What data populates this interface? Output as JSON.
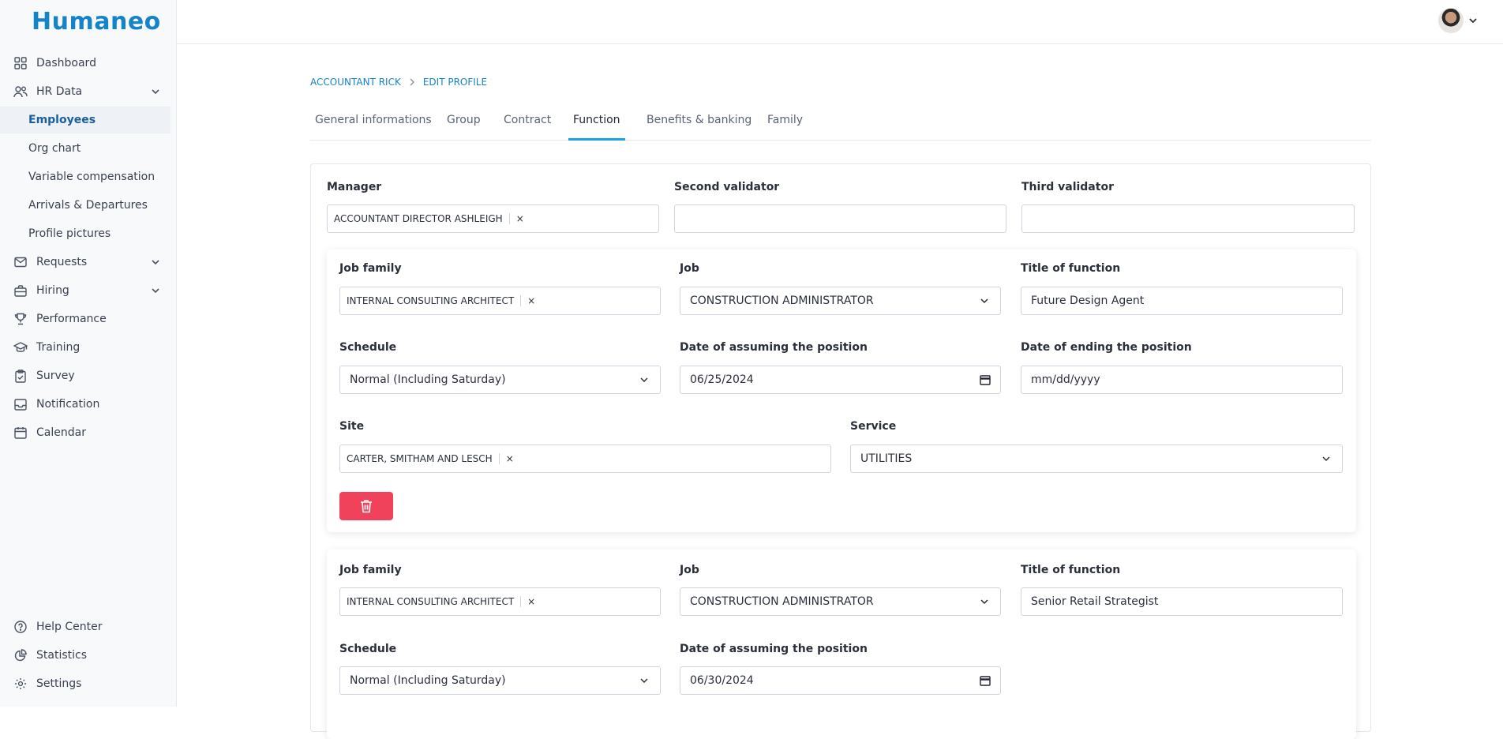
{
  "app": {
    "logo": "Humaneo"
  },
  "sidebar": {
    "items": [
      {
        "label": "Dashboard",
        "icon": "dashboard-icon"
      },
      {
        "label": "HR Data",
        "icon": "people-icon"
      },
      {
        "label": "Employees"
      },
      {
        "label": "Org chart"
      },
      {
        "label": "Variable compensation"
      },
      {
        "label": "Arrivals & Departures"
      },
      {
        "label": "Profile pictures"
      },
      {
        "label": "Requests",
        "icon": "mail-icon"
      },
      {
        "label": "Hiring",
        "icon": "briefcase-icon"
      },
      {
        "label": "Performance",
        "icon": "trophy-icon"
      },
      {
        "label": "Training",
        "icon": "graduation-cap-icon"
      },
      {
        "label": "Survey",
        "icon": "clipboard-icon"
      },
      {
        "label": "Notification",
        "icon": "inbox-icon"
      },
      {
        "label": "Calendar",
        "icon": "calendar-icon"
      }
    ],
    "bottom": [
      {
        "label": "Help Center",
        "icon": "help-icon"
      },
      {
        "label": "Statistics",
        "icon": "chart-pie-icon"
      },
      {
        "label": "Settings",
        "icon": "gear-icon"
      }
    ]
  },
  "breadcrumb": {
    "parent": "ACCOUNTANT RICK",
    "current": "EDIT PROFILE"
  },
  "tabs": [
    "General informations",
    "Group",
    "Contract",
    "Function",
    "Benefits & banking",
    "Family"
  ],
  "validators": {
    "manager_label": "Manager",
    "manager_value": "ACCOUNTANT DIRECTOR ASHLEIGH",
    "second_label": "Second validator",
    "second_value": "",
    "third_label": "Third validator",
    "third_value": ""
  },
  "functions": [
    {
      "job_family_label": "Job family",
      "job_family": "INTERNAL CONSULTING ARCHITECT",
      "job_label": "Job",
      "job": "CONSTRUCTION ADMINISTRATOR",
      "title_label": "Title of function",
      "title": "Future Design Agent",
      "schedule_label": "Schedule",
      "schedule": "Normal (Including Saturday)",
      "start_label": "Date of assuming the position",
      "start": "06/25/2024",
      "end_label": "Date of ending the position",
      "end": "mm/dd/yyyy",
      "site_label": "Site",
      "site": "CARTER, SMITHAM AND LESCH",
      "service_label": "Service",
      "service": "UTILITIES"
    },
    {
      "job_family_label": "Job family",
      "job_family": "INTERNAL CONSULTING ARCHITECT",
      "job_label": "Job",
      "job": "CONSTRUCTION ADMINISTRATOR",
      "title_label": "Title of function",
      "title": "Senior Retail Strategist",
      "schedule_label": "Schedule",
      "schedule": "Normal (Including Saturday)",
      "start_label": "Date of assuming the position",
      "start": "06/30/2024"
    }
  ],
  "tag_remove": "×",
  "colors": {
    "brand": "#1583c9",
    "active_tab": "#1aa3e6",
    "danger": "#f0425a"
  }
}
